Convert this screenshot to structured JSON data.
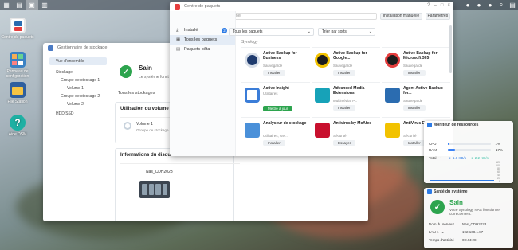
{
  "storage_manager": {
    "title": "Gestionnaire de stockage",
    "nav": [
      {
        "label": "Vue d'ensemble"
      },
      {
        "label": "Stockage"
      },
      {
        "label": "Groupe de stockage 1"
      },
      {
        "label": "Volume 1"
      },
      {
        "label": "Groupe de stockage 2"
      },
      {
        "label": "Volume 2"
      },
      {
        "label": "HDD/SSD"
      }
    ],
    "status_title": "Sain",
    "status_text": "Le système fonct",
    "section_storage": "Tous les stockages",
    "usage_title": "Utilisation du volume",
    "volume_name": "Volume 1",
    "volume_sub": "Groupe de stockage",
    "disk_info_title": "Informations du disque",
    "server_name": "Nas_CDH2023"
  },
  "package_center": {
    "title": "Centre de paquets",
    "search_placeholder": "Rechercher",
    "manual_install": "Installation manuelle",
    "settings": "Paramètres",
    "nav": [
      {
        "label": "Installé",
        "badge": "2"
      },
      {
        "label": "Tous les paquets"
      },
      {
        "label": "Paquets bêta"
      }
    ],
    "filter_all": "Tous les paquets",
    "sort": "Trier par sorts",
    "section_label": "Synology",
    "packages": [
      {
        "name": "Active Backup for Business",
        "category": "Sauvegarde",
        "button": "Installer",
        "color": "#1f3b6e"
      },
      {
        "name": "Active Backup for Google...",
        "category": "Sauvegarde",
        "button": "Installer",
        "color": "#1c1c1c"
      },
      {
        "name": "Active Backup for Microsoft 365",
        "category": "Sauvegarde",
        "button": "Installer",
        "color": "#1c1c1c"
      },
      {
        "name": "Active Insight",
        "category": "Utilitaires",
        "button": "Mettre à jour",
        "color": "#3b7dd8"
      },
      {
        "name": "Advanced Media Extensions",
        "category": "Multimédia, P...",
        "button": "Installer",
        "color": "#17a2b8"
      },
      {
        "name": "Agent Active Backup for...",
        "category": "Sauvegarde",
        "button": "Installer",
        "color": "#2b6cb0"
      },
      {
        "name": "Analyseur de stockage",
        "category": "Utilitaires, Ge...",
        "button": "Installer",
        "color": "#4a90d9"
      },
      {
        "name": "Antivirus by McAfee",
        "category": "Sécurité",
        "button": "Essayer",
        "color": "#c8102e"
      },
      {
        "name": "AntiVirus Essential",
        "category": "Sécurité",
        "button": "Installer",
        "color": "#f2c200"
      }
    ]
  },
  "resource_monitor": {
    "title": "Moniteur de ressources",
    "cpu_label": "CPU",
    "cpu_value": "1%",
    "cpu_fraction": 0.01,
    "ram_label": "RAM",
    "ram_value": "17%",
    "ram_fraction": 0.17,
    "total_label": "Total",
    "upload": "1.8 KB/s",
    "download": "2.2 KB/s",
    "axis": [
      "120",
      "100",
      "80",
      "60",
      "40",
      "20",
      "0"
    ]
  },
  "system_health": {
    "title": "Santé du système",
    "status": "Sain",
    "status_text": "Votre Synology NAS fonctionne correctement.",
    "server_label": "Nom du serveur",
    "server_value": "Nas_CDH2023",
    "lan_label": "LAN 1",
    "lan_value": "192.168.1.87",
    "uptime_label": "Temps d'activité",
    "uptime_value": "00:44:28"
  },
  "desktop_icons": [
    {
      "label": "Centre de paquets",
      "icon": "package-center-icon"
    },
    {
      "label": "Panneau de configuration",
      "icon": "control-panel-icon"
    },
    {
      "label": "File Station",
      "icon": "file-station-icon"
    },
    {
      "label": "Aide DSM",
      "icon": "help-icon"
    }
  ],
  "colors": {
    "accent": "#2d7be5",
    "green": "#2da44e"
  }
}
